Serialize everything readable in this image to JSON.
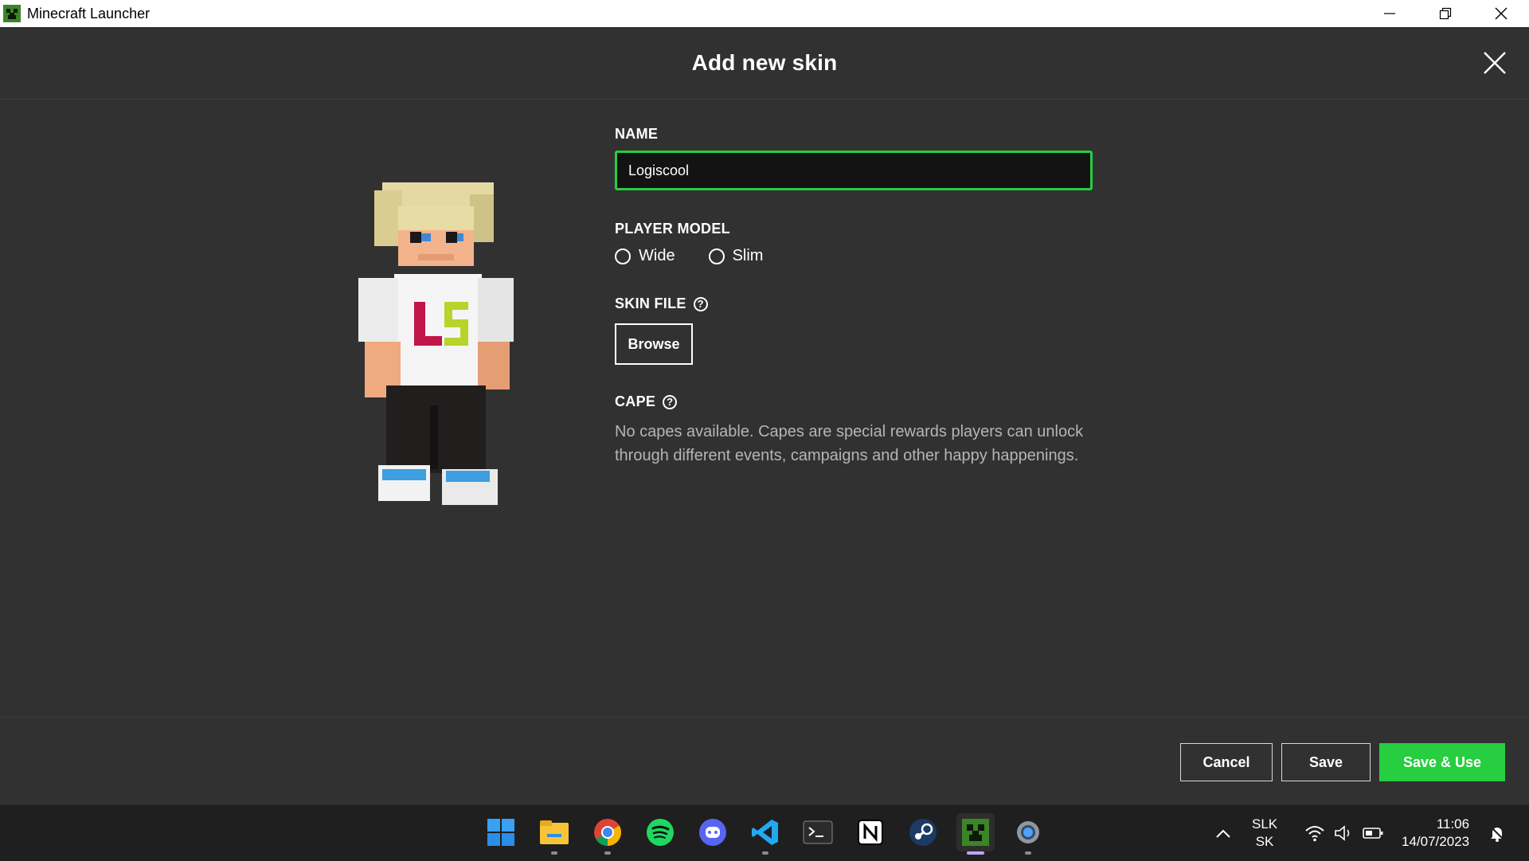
{
  "window": {
    "title": "Minecraft Launcher"
  },
  "dialog": {
    "title": "Add new skin",
    "name_label": "NAME",
    "name_value": "Logiscool",
    "player_model_label": "PLAYER MODEL",
    "models": [
      "Wide",
      "Slim"
    ],
    "skin_file_label": "SKIN FILE",
    "browse_label": "Browse",
    "cape_label": "CAPE",
    "cape_text": "No capes available. Capes are special rewards players can unlock through different events, campaigns and other happy happenings.",
    "help_glyph": "?",
    "accent_color": "#27ce40"
  },
  "footer": {
    "cancel_label": "Cancel",
    "save_label": "Save",
    "save_use_label": "Save & Use"
  },
  "taskbar": {
    "apps": [
      "start-icon",
      "file-explorer-icon",
      "chrome-icon",
      "spotify-icon",
      "discord-icon",
      "vscode-icon",
      "terminal-icon",
      "notion-icon",
      "steam-icon",
      "minecraft-launcher-icon",
      "settings-icon"
    ],
    "lang_primary": "SLK",
    "lang_secondary": "SK",
    "time": "11:06",
    "date": "14/07/2023"
  }
}
